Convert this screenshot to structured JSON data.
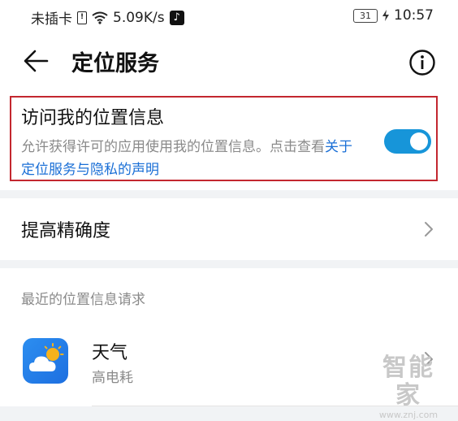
{
  "status_bar": {
    "carrier": "未插卡",
    "speed": "5.09K/s",
    "battery": "31",
    "time": "10:57"
  },
  "header": {
    "title": "定位服务"
  },
  "location_access": {
    "title": "访问我的位置信息",
    "description": "允许获得许可的应用使用我的位置信息。点击查看",
    "link": "关于定位服务与隐私的声明",
    "enabled": true,
    "toggle_color": "#1795d9",
    "highlight_color": "#c3272f"
  },
  "accuracy": {
    "label": "提高精确度"
  },
  "recent_requests": {
    "header": "最近的位置信息请求",
    "apps": [
      {
        "name": "天气",
        "usage": "高电耗",
        "icon": "weather-app-icon"
      }
    ]
  },
  "watermark": {
    "main": "智能家",
    "sub": "www.znj.com"
  }
}
